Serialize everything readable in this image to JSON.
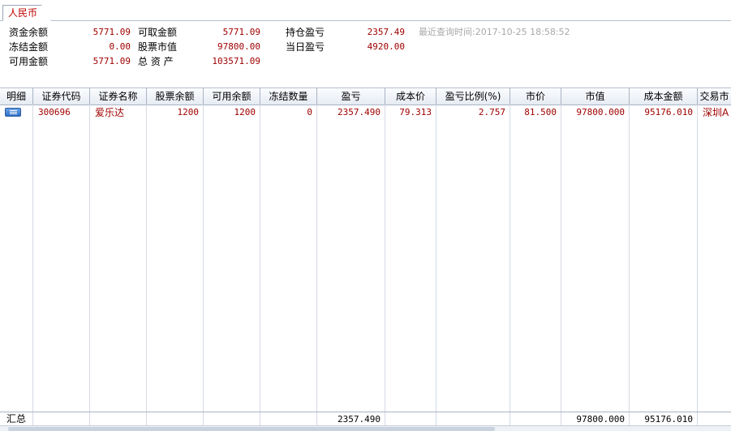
{
  "tab": {
    "label": "人民币"
  },
  "summary": {
    "fund_balance_label": "资金余额",
    "fund_balance": "5771.09",
    "withdrawable_label": "可取金额",
    "withdrawable": "5771.09",
    "position_pl_label": "持仓盈亏",
    "position_pl": "2357.49",
    "frozen_label": "冻结金额",
    "frozen": "0.00",
    "stock_value_label": "股票市值",
    "stock_value": "97800.00",
    "daily_pl_label": "当日盈亏",
    "daily_pl": "4920.00",
    "available_label": "可用金额",
    "available": "5771.09",
    "total_assets_label": "总 资 产",
    "total_assets": "103571.09",
    "query_time": "最近查询时间:2017-10-25 18:58:52"
  },
  "table": {
    "columns": [
      "明细",
      "证券代码",
      "证券名称",
      "股票余额",
      "可用余额",
      "冻结数量",
      "盈亏",
      "成本价",
      "盈亏比例(%)",
      "市价",
      "市值",
      "成本金额",
      "交易市"
    ],
    "rows": [
      {
        "code": "300696",
        "name": "爱乐达",
        "stock_balance": "1200",
        "available_balance": "1200",
        "frozen_qty": "0",
        "pl": "2357.490",
        "cost_price": "79.313",
        "pl_ratio": "2.757",
        "price": "81.500",
        "market_value": "97800.000",
        "cost_amount": "95176.010",
        "market": "深圳A"
      }
    ],
    "footer": {
      "label": "汇总",
      "pl": "2357.490",
      "market_value": "97800.000",
      "cost_amount": "95176.010"
    }
  }
}
